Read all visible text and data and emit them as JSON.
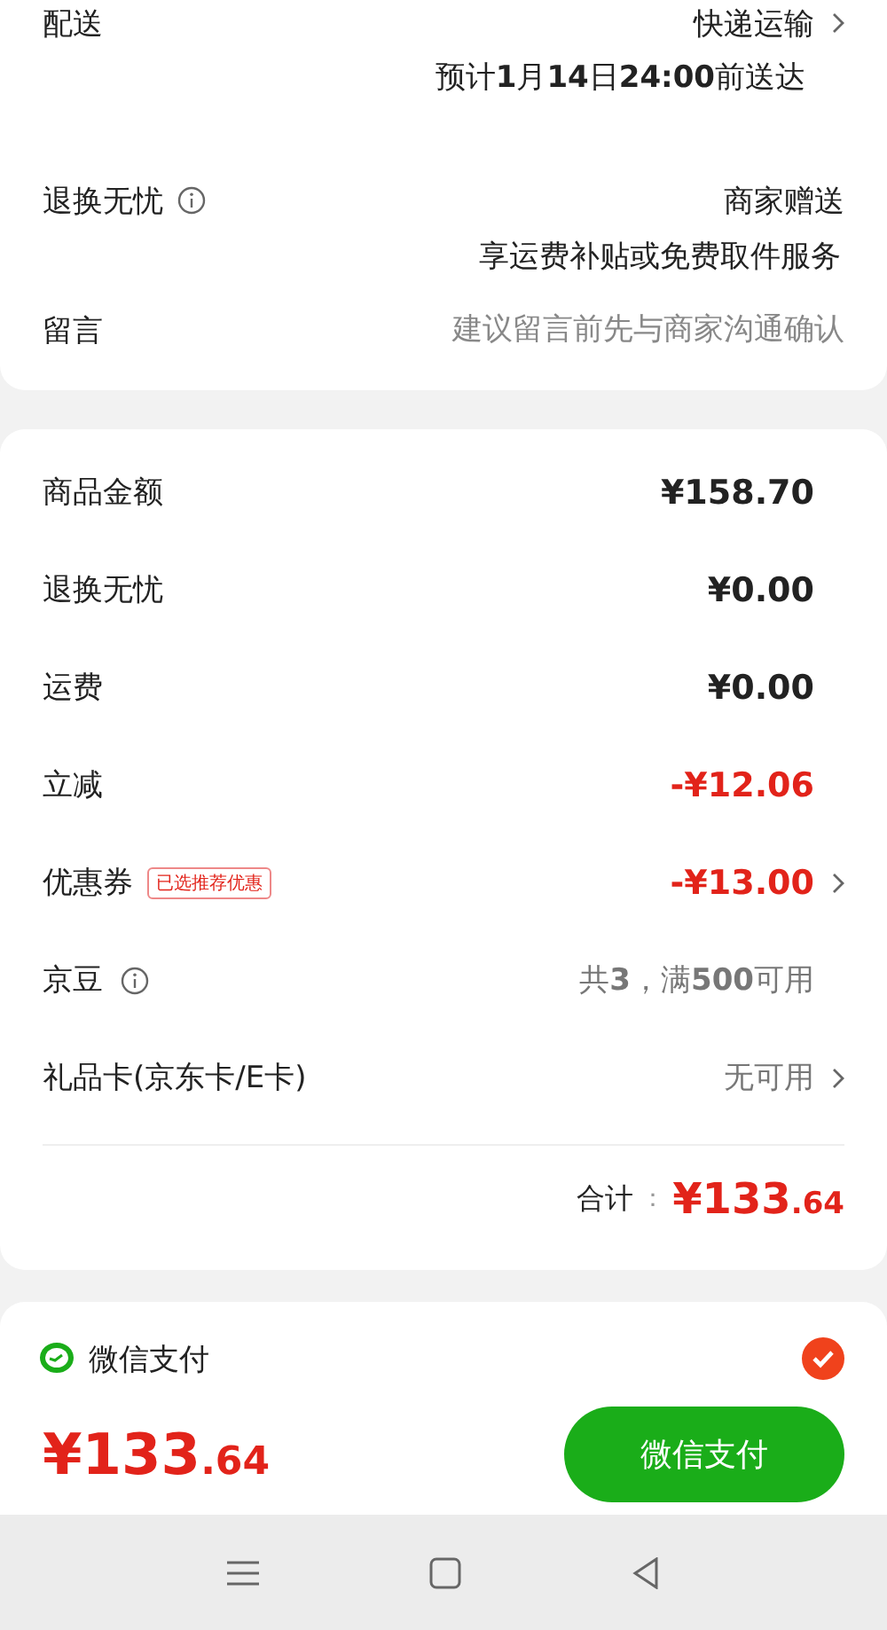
{
  "delivery": {
    "label": "配送",
    "value": "快递运输",
    "note": "预计**1**月**14**日**24:00**前送达"
  },
  "return_service": {
    "label": "退换无忧",
    "value": "商家赠送",
    "note": "享运费补贴或免费取件服务"
  },
  "message": {
    "label": "留言",
    "placeholder": "建议留言前先与商家沟通确认"
  },
  "price_rows": [
    {
      "label": "商品金额",
      "value": "¥158.70",
      "kind": "amount",
      "info": false,
      "chevron": false
    },
    {
      "label": "退换无忧",
      "value": "¥0.00",
      "kind": "amount",
      "info": false,
      "chevron": false
    },
    {
      "label": "运费",
      "value": "¥0.00",
      "kind": "amount",
      "info": false,
      "chevron": false
    },
    {
      "label": "立减",
      "value": "-¥12.06",
      "kind": "discount",
      "info": false,
      "chevron": false
    },
    {
      "label": "优惠券",
      "badge": "已选推荐优惠",
      "value": "-¥13.00",
      "kind": "discount",
      "info": false,
      "chevron": true
    },
    {
      "label": "京豆",
      "value": "共**3**，满**500**可用",
      "kind": "muted",
      "info": true,
      "chevron": false
    },
    {
      "label": "礼品卡(京东卡/E卡)",
      "value": "无可用",
      "kind": "muted",
      "info": false,
      "chevron": true
    }
  ],
  "total": {
    "label": "合计",
    "separator": "：",
    "value": "¥133.64"
  },
  "payment": {
    "name": "微信支付",
    "selected": true
  },
  "footer": {
    "amount": "¥133.64",
    "button": "微信支付"
  }
}
